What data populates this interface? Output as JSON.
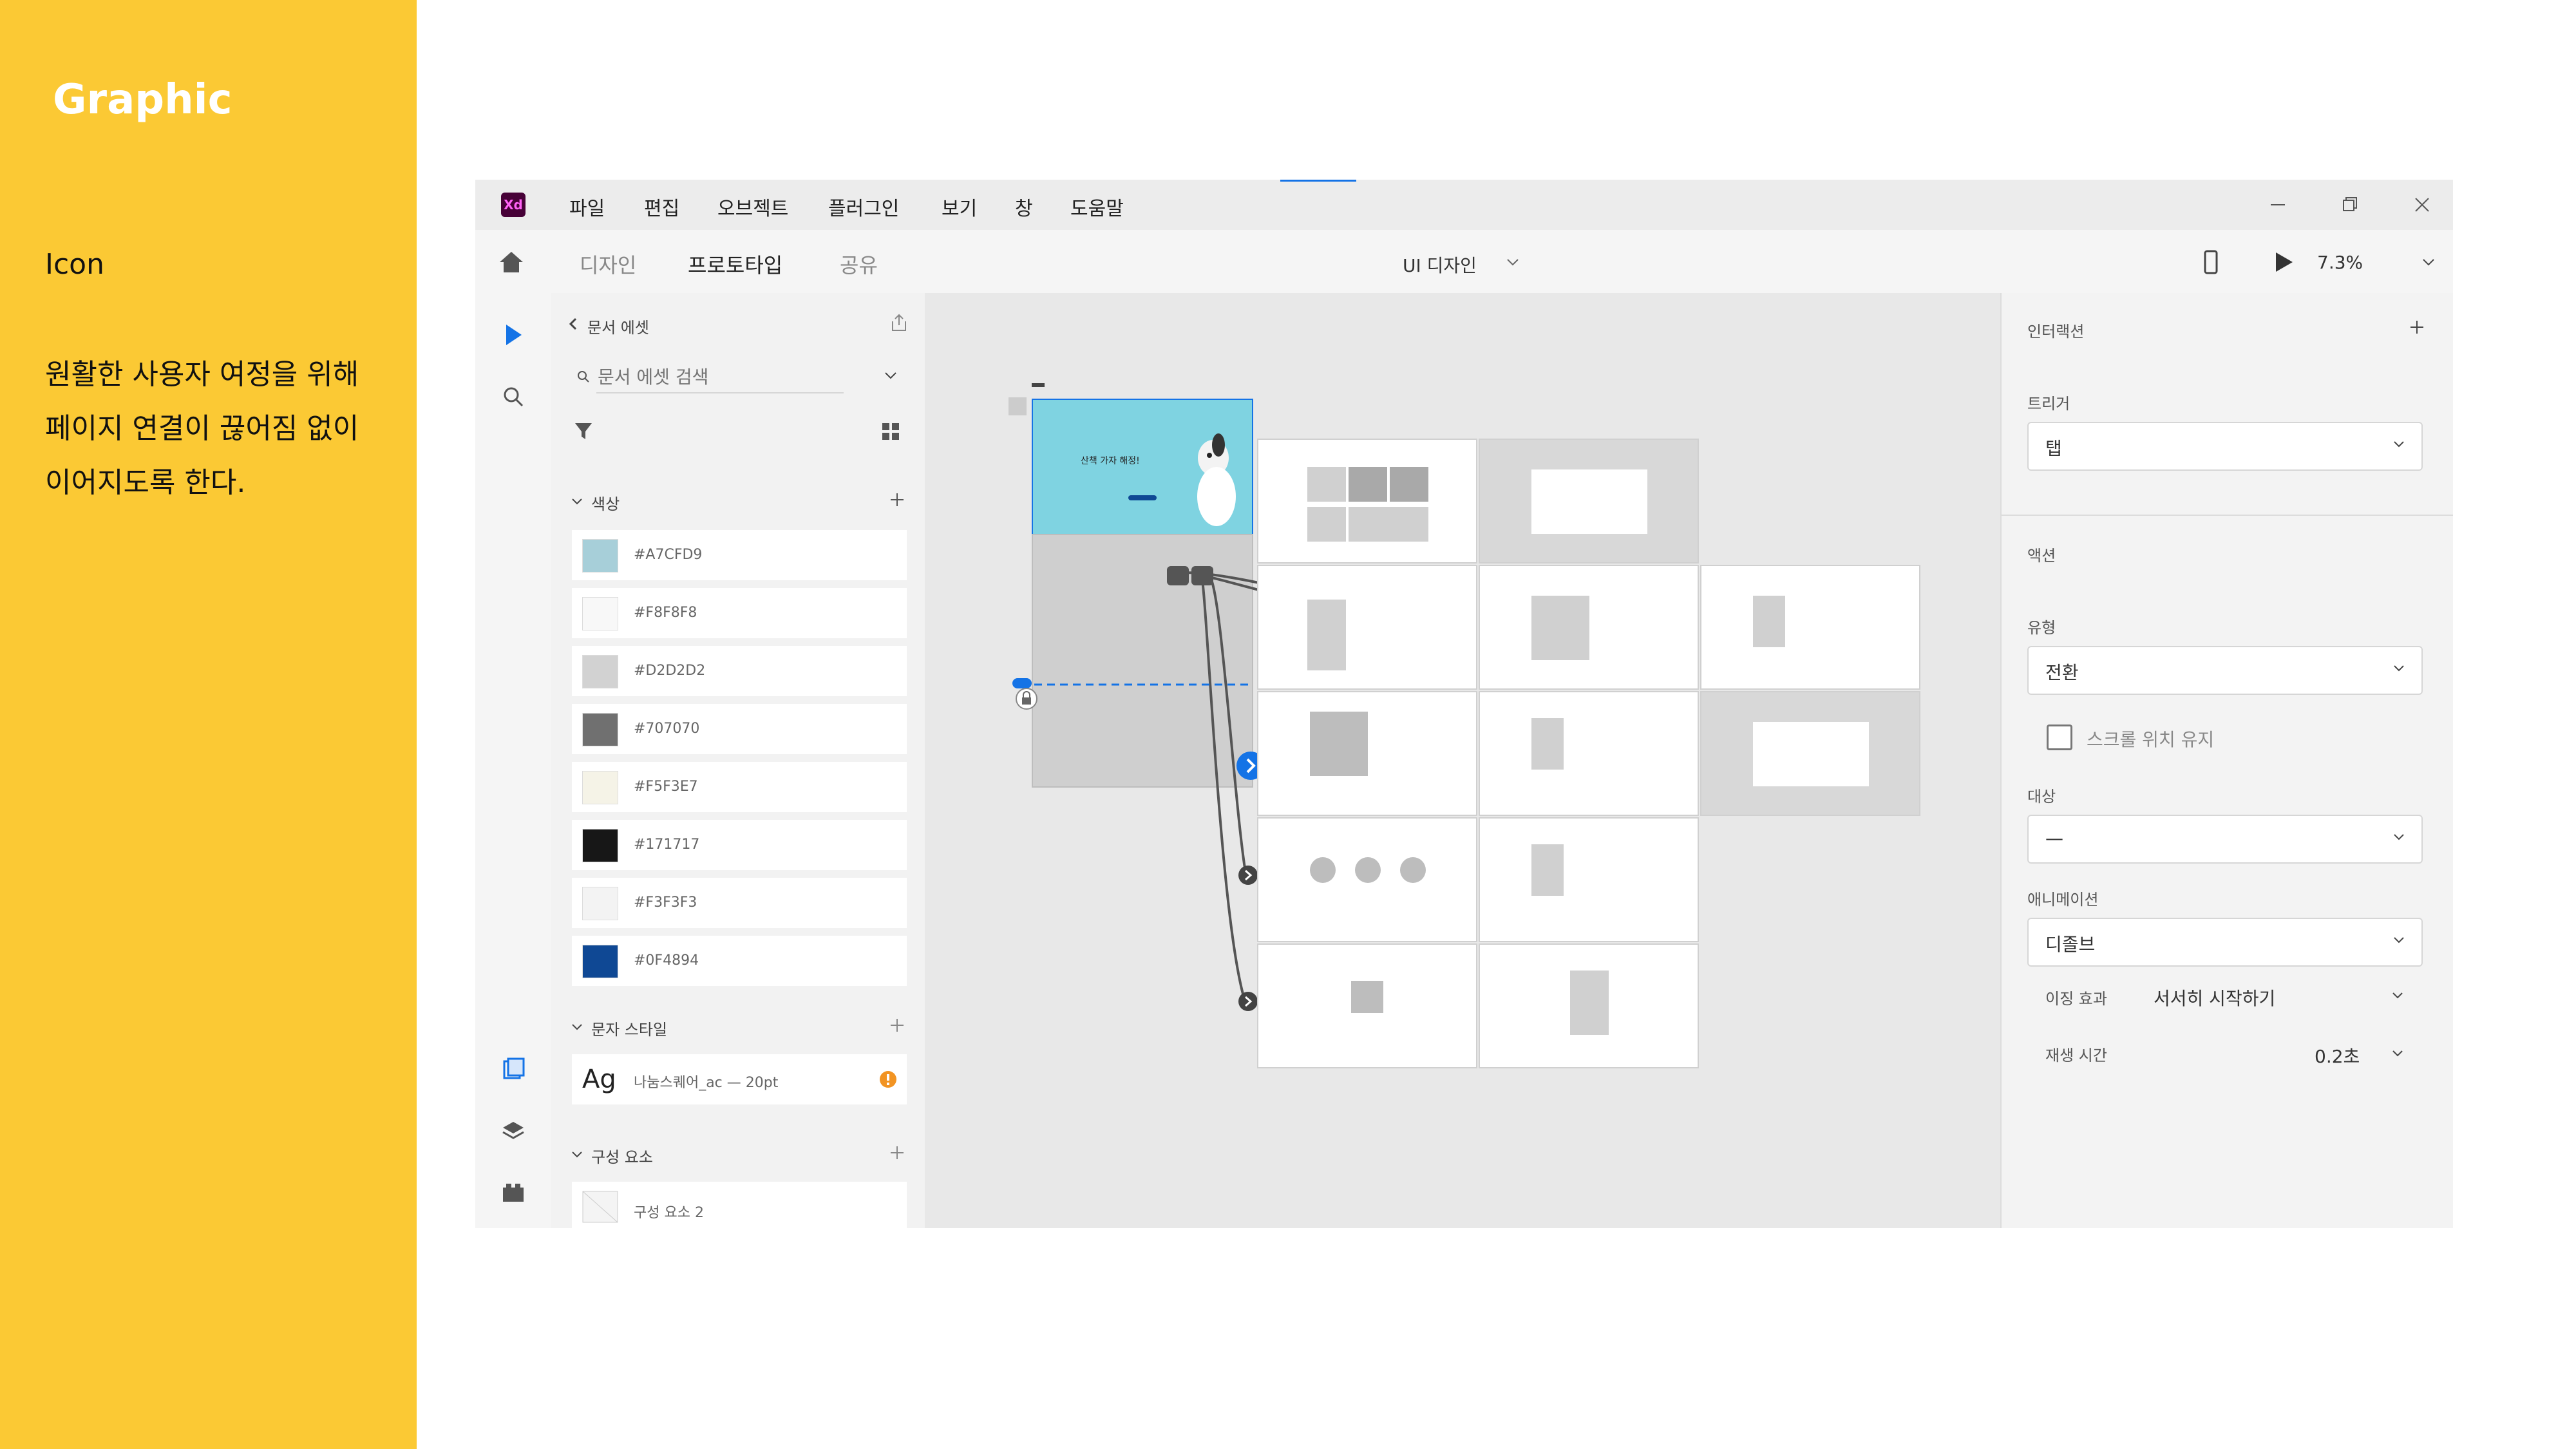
{
  "slide": {
    "title": "Graphic",
    "subtitle": "Icon",
    "description": [
      "원활한 사용자 여정을 위해",
      "페이지 연결이 끊어짐 없이",
      "이어지도록 한다."
    ]
  },
  "app": {
    "logo": "Xd",
    "menu": [
      "파일",
      "편집",
      "오브젝트",
      "플러그인",
      "보기",
      "창",
      "도움말"
    ],
    "tabs": [
      "디자인",
      "프로토타입",
      "공유"
    ],
    "active_tab": "프로토타입",
    "document_name": "UI 디자인",
    "zoom": "7.3%"
  },
  "assets": {
    "back_label": "문서 에셋",
    "search_placeholder": "문서 에셋 검색",
    "colors_header": "색상",
    "colors": [
      {
        "hex": "#A7CFD9"
      },
      {
        "hex": "#F8F8F8"
      },
      {
        "hex": "#D2D2D2"
      },
      {
        "hex": "#707070"
      },
      {
        "hex": "#F5F3E7"
      },
      {
        "hex": "#171717"
      },
      {
        "hex": "#F3F3F3"
      },
      {
        "hex": "#0F4894"
      }
    ],
    "char_styles_header": "문자 스타일",
    "char_style": {
      "sample": "Ag",
      "label": "나눔스퀘어_ac — 20pt"
    },
    "components_header": "구성 요소",
    "component": "구성 요소 2"
  },
  "canvas": {
    "hero_text": "산책 가자 해정!"
  },
  "props": {
    "interaction_title": "인터랙션",
    "trigger_label": "트리거",
    "trigger_value": "탭",
    "action_title": "액션",
    "type_label": "유형",
    "type_value": "전환",
    "preserve_scroll": "스크롤 위치 유지",
    "target_label": "대상",
    "target_value": "—",
    "animation_label": "애니메이션",
    "animation_value": "디졸브",
    "easing_label": "이징 효과",
    "easing_value": "서서히 시작하기",
    "duration_label": "재생 시간",
    "duration_value": "0.2초"
  }
}
